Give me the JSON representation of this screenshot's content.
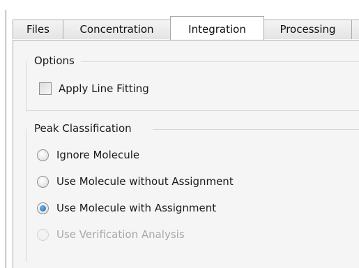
{
  "tabs": [
    {
      "label": "Files",
      "selected": false
    },
    {
      "label": "Concentration",
      "selected": false
    },
    {
      "label": "Integration",
      "selected": true
    },
    {
      "label": "Processing",
      "selected": false
    }
  ],
  "options": {
    "title": "Options",
    "apply_line_fitting": {
      "label": "Apply Line Fitting",
      "checked": false
    }
  },
  "peak_classification": {
    "title": "Peak Classification",
    "choices": [
      {
        "label": "Ignore Molecule",
        "selected": false,
        "enabled": true
      },
      {
        "label": "Use Molecule without Assignment",
        "selected": false,
        "enabled": true
      },
      {
        "label": "Use Molecule with Assignment",
        "selected": true,
        "enabled": true
      },
      {
        "label": "Use Verification Analysis",
        "selected": false,
        "enabled": false
      }
    ]
  },
  "colors": {
    "selected_radio": "#1d5fa8",
    "disabled_text": "#a8a8a8",
    "panel_bg": "#f5f5f5"
  }
}
